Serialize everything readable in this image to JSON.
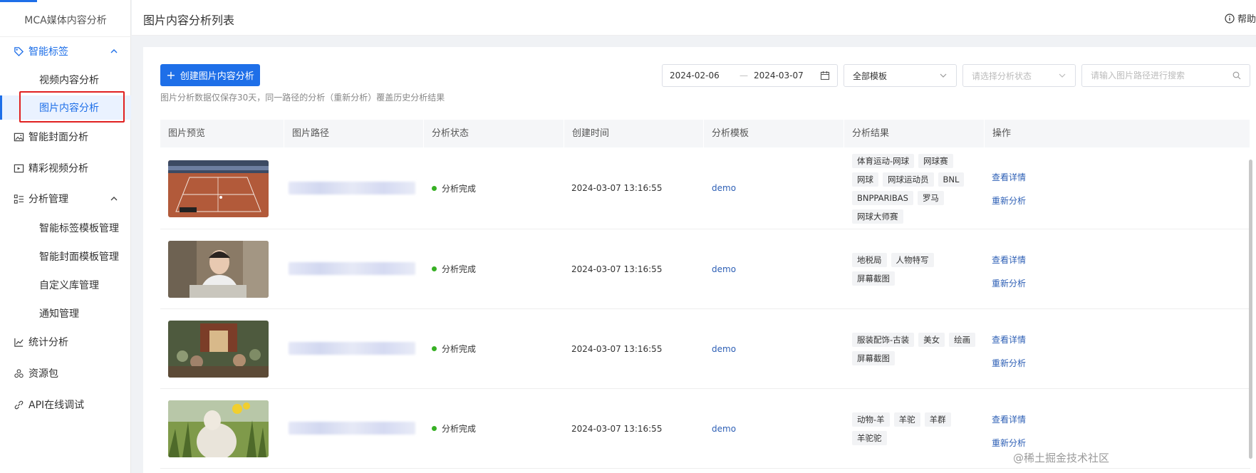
{
  "app": {
    "brand": "MCA媒体内容分析"
  },
  "sidebar": {
    "items": [
      {
        "label": "智能标签",
        "icon": "tag-icon"
      },
      {
        "label": "视频内容分析"
      },
      {
        "label": "图片内容分析"
      },
      {
        "label": "智能封面分析",
        "icon": "image-icon"
      },
      {
        "label": "精彩视频分析",
        "icon": "video-icon"
      },
      {
        "label": "分析管理",
        "icon": "list-icon"
      },
      {
        "label": "智能标签模板管理"
      },
      {
        "label": "智能封面模板管理"
      },
      {
        "label": "自定义库管理"
      },
      {
        "label": "通知管理"
      },
      {
        "label": "统计分析",
        "icon": "chart-icon"
      },
      {
        "label": "资源包",
        "icon": "package-icon"
      },
      {
        "label": "API在线调试",
        "icon": "link-icon"
      }
    ]
  },
  "header": {
    "title": "图片内容分析列表",
    "help": "帮助"
  },
  "toolbar": {
    "create_label": "创建图片内容分析",
    "hint": "图片分析数据仅保存30天，同一路径的分析（重新分析）覆盖历史分析结果",
    "date_start": "2024-02-06",
    "date_sep": "—",
    "date_end": "2024-03-07",
    "template_value": "全部模板",
    "status_placeholder": "请选择分析状态",
    "search_placeholder": "请输入图片路径进行搜索"
  },
  "table": {
    "columns": [
      "图片预览",
      "图片路径",
      "分析状态",
      "创建时间",
      "分析模板",
      "分析结果",
      "操作"
    ],
    "rows": [
      {
        "status": "分析完成",
        "created": "2024-03-07 13:16:55",
        "template": "demo",
        "tags": [
          "体育运动-网球",
          "网球赛",
          "网球",
          "网球运动员",
          "BNL",
          "BNPPARIBAS",
          "罗马",
          "网球大师赛"
        ],
        "ops": [
          "查看详情",
          "重新分析"
        ]
      },
      {
        "status": "分析完成",
        "created": "2024-03-07 13:16:55",
        "template": "demo",
        "tags": [
          "地税局",
          "人物特写",
          "屏幕截图"
        ],
        "ops": [
          "查看详情",
          "重新分析"
        ]
      },
      {
        "status": "分析完成",
        "created": "2024-03-07 13:16:55",
        "template": "demo",
        "tags": [
          "服装配饰-古装",
          "美女",
          "绘画",
          "屏幕截图"
        ],
        "ops": [
          "查看详情",
          "重新分析"
        ]
      },
      {
        "status": "分析完成",
        "created": "2024-03-07 13:16:55",
        "template": "demo",
        "tags": [
          "动物-羊",
          "羊驼",
          "羊群",
          "羊驼驼"
        ],
        "ops": [
          "查看详情",
          "重新分析"
        ]
      }
    ]
  },
  "watermark": "@稀土掘金技术社区",
  "colors": {
    "primary": "#1e6fe8",
    "success": "#37b024",
    "highlight": "#e02020"
  }
}
